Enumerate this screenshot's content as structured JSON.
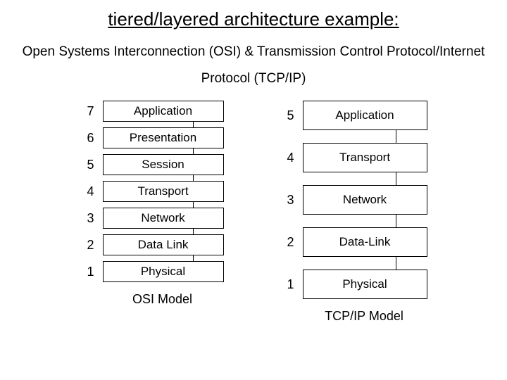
{
  "title": "tiered/layered  architecture example:",
  "subtitle": "Open Systems Interconnection (OSI) & Transmission Control Protocol/Internet Protocol (TCP/IP)",
  "osi": {
    "label": "OSI Model",
    "layers": [
      {
        "num": "7",
        "name": "Application"
      },
      {
        "num": "6",
        "name": "Presentation"
      },
      {
        "num": "5",
        "name": "Session"
      },
      {
        "num": "4",
        "name": "Transport"
      },
      {
        "num": "3",
        "name": "Network"
      },
      {
        "num": "2",
        "name": "Data Link"
      },
      {
        "num": "1",
        "name": "Physical"
      }
    ]
  },
  "tcpip": {
    "label": "TCP/IP Model",
    "layers": [
      {
        "num": "5",
        "name": "Application"
      },
      {
        "num": "4",
        "name": "Transport"
      },
      {
        "num": "3",
        "name": "Network"
      },
      {
        "num": "2",
        "name": "Data-Link"
      },
      {
        "num": "1",
        "name": "Physical"
      }
    ]
  }
}
